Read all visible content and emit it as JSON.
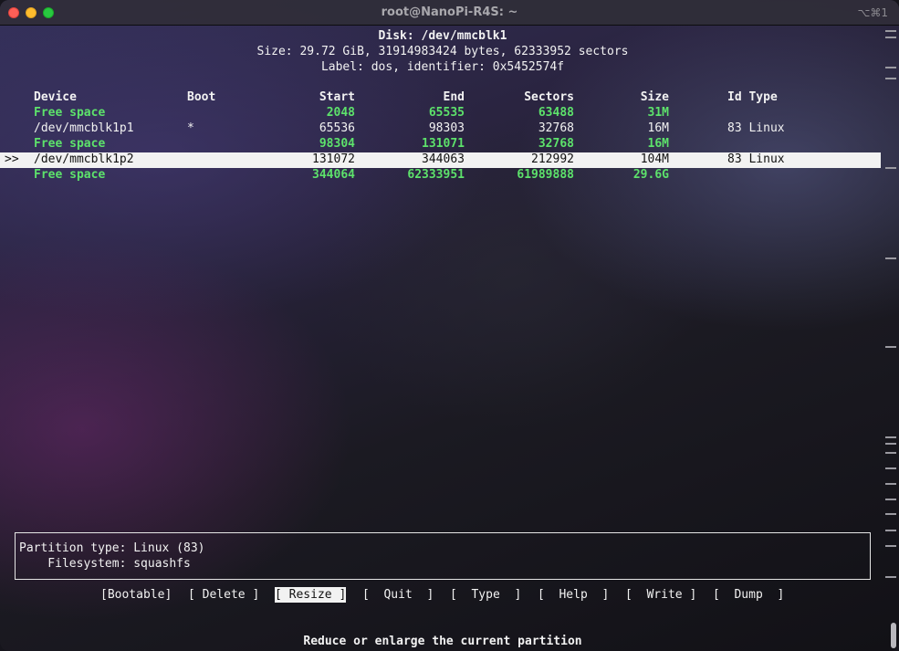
{
  "window": {
    "title": "root@NanoPi-R4S: ~",
    "shortcut": "⌥⌘1"
  },
  "disk": {
    "line1": "Disk: /dev/mmcblk1",
    "line2": "Size: 29.72 GiB, 31914983424 bytes, 62333952 sectors",
    "line3": "Label: dos, identifier: 0x5452574f"
  },
  "table": {
    "headers": {
      "device": "Device",
      "boot": "Boot",
      "start": "Start",
      "end": "End",
      "sectors": "Sectors",
      "size": "Size",
      "idtype": "Id Type"
    },
    "rows": [
      {
        "marker": "",
        "device": "Free space",
        "boot": "",
        "start": "2048",
        "end": "65535",
        "sectors": "63488",
        "size": "31M",
        "idtype": ""
      },
      {
        "marker": "",
        "device": "/dev/mmcblk1p1",
        "boot": "*",
        "start": "65536",
        "end": "98303",
        "sectors": "32768",
        "size": "16M",
        "idtype": "83 Linux"
      },
      {
        "marker": "",
        "device": "Free space",
        "boot": "",
        "start": "98304",
        "end": "131071",
        "sectors": "32768",
        "size": "16M",
        "idtype": ""
      },
      {
        "marker": ">>",
        "device": "/dev/mmcblk1p2",
        "boot": "",
        "start": "131072",
        "end": "344063",
        "sectors": "212992",
        "size": "104M",
        "idtype": "83 Linux"
      },
      {
        "marker": "",
        "device": "Free space",
        "boot": "",
        "start": "344064",
        "end": "62333951",
        "sectors": "61989888",
        "size": "29.6G",
        "idtype": ""
      }
    ]
  },
  "info": {
    "partition_type": "Partition type: Linux (83)",
    "filesystem": "    Filesystem: squashfs"
  },
  "menu": {
    "bootable": "[Bootable]",
    "delete": "[ Delete ]",
    "resize": "[ Resize ]",
    "quit": "[  Quit  ]",
    "type": "[  Type  ]",
    "help": "[  Help  ]",
    "write": "[  Write ]",
    "dump": "[  Dump  ]"
  },
  "status": "Reduce or enlarge the current partition",
  "colors": {
    "free_space": "#5de26b",
    "selected_bg": "#f2f2f2"
  }
}
